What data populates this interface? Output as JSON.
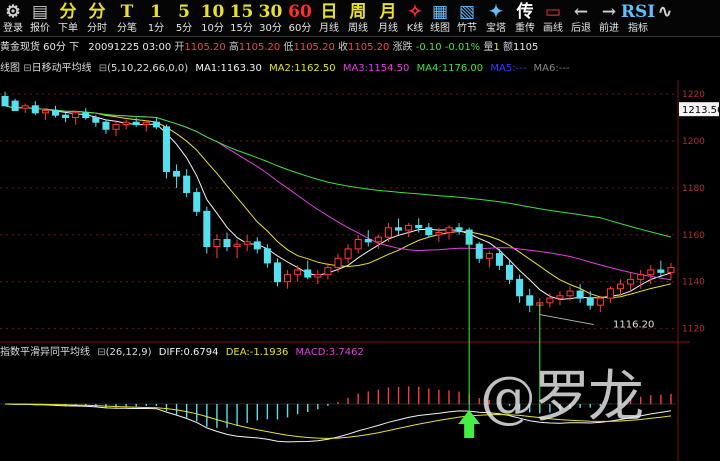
{
  "toolbar": [
    {
      "glyph": "⚙",
      "label": "登录",
      "color": "#d0d0d0",
      "w": 26
    },
    {
      "glyph": "▤",
      "label": "报价",
      "color": "#d0d0d0",
      "w": 28
    },
    {
      "glyph": "分",
      "label": "下单",
      "color": "#e8e030",
      "w": 28
    },
    {
      "glyph": "分",
      "label": "分时",
      "color": "#e8e030",
      "w": 30
    },
    {
      "glyph": "T",
      "label": "分笔",
      "color": "#e8e030",
      "w": 30
    },
    {
      "glyph": "1",
      "label": "1分",
      "color": "#e8e030",
      "w": 28
    },
    {
      "glyph": "5",
      "label": "5分",
      "color": "#e8e030",
      "w": 28
    },
    {
      "glyph": "10",
      "label": "10分",
      "color": "#e8e030",
      "w": 29
    },
    {
      "glyph": "15",
      "label": "15分",
      "color": "#e8e030",
      "w": 29
    },
    {
      "glyph": "30",
      "label": "30分",
      "color": "#e8e030",
      "w": 29
    },
    {
      "glyph": "60",
      "label": "60分",
      "color": "#ff3030",
      "w": 30
    },
    {
      "glyph": "日",
      "label": "月线",
      "color": "#e8e030",
      "w": 28
    },
    {
      "glyph": "周",
      "label": "周线",
      "color": "#e8e030",
      "w": 30
    },
    {
      "glyph": "月",
      "label": "月线",
      "color": "#e8e030",
      "w": 30
    },
    {
      "glyph": "✧",
      "label": "K线",
      "color": "#ff3030",
      "w": 24
    },
    {
      "glyph": "▦",
      "label": "线图",
      "color": "#60c0ff",
      "w": 26
    },
    {
      "glyph": "▧",
      "label": "竹节",
      "color": "#60c0ff",
      "w": 28
    },
    {
      "glyph": "✦",
      "label": "宝塔",
      "color": "#60c0ff",
      "w": 30
    },
    {
      "glyph": "传",
      "label": "重传",
      "color": "#ffffff",
      "w": 28
    },
    {
      "glyph": "▭",
      "label": "画线",
      "color": "#ff3030",
      "w": 28
    },
    {
      "glyph": "←",
      "label": "后退",
      "color": "#d0d0d0",
      "w": 28
    },
    {
      "glyph": "→",
      "label": "前进",
      "color": "#d0d0d0",
      "w": 28
    },
    {
      "glyph": "RSI",
      "label": "指标",
      "color": "#60c0ff",
      "w": 30
    },
    {
      "glyph": "∿",
      "label": "",
      "color": "#d0d0d0",
      "w": 24
    }
  ],
  "quote": {
    "name": "黄金现货 60分 下",
    "date": "20091225 03:00",
    "open_label": "开",
    "open": "1105.20",
    "high_label": "高",
    "high": "1105.20",
    "low_label": "低",
    "low": "1105.20",
    "close_label": "收",
    "close": "1105.20",
    "change_label": "涨跌",
    "change": "-0.10",
    "pct": "-0.01%",
    "volume_label": "量",
    "volume": "1",
    "hold_label": "额",
    "hold": "1105"
  },
  "ma_bar": {
    "title": "线图",
    "indicator": "日移动平均线",
    "params": "(5,10,22,66,0,0)",
    "ma1": "MA1:1163.30",
    "ma2": "MA2:1162.50",
    "ma3": "MA3:1154.50",
    "ma4": "MA4:1176.00",
    "ma5": "MA5:---",
    "ma6": "MA6:---"
  },
  "macd_bar": {
    "title": "指数平滑异同平均线",
    "params": "(26,12,9)",
    "diff": "DIFF:0.6794",
    "dea": "DEA:-1.1936",
    "macd": "MACD:3.7462"
  },
  "axis_labels": [
    "1220",
    "1200",
    "1180",
    "1160",
    "1140",
    "1120"
  ],
  "current_price_tag": "1213.56",
  "low_marker": "1116.20",
  "watermark": "@罗龙",
  "colors": {
    "up": "#ff3a3a",
    "down": "#54e0ee",
    "ma1": "#f4f4f4",
    "ma2": "#e8e030",
    "ma3": "#e040e0",
    "ma4": "#40e040",
    "signal_arrow": "#44ee44",
    "grid": "#7a1515"
  },
  "chart_data": {
    "type": "candlestick",
    "price_range": [
      1116,
      1226
    ],
    "price_labels": [
      1220,
      1200,
      1180,
      1160,
      1140,
      1120
    ],
    "candles": [
      [
        1219,
        1221,
        1217,
        1215
      ],
      [
        1217,
        1218,
        1214,
        1213
      ],
      [
        1214,
        1216,
        1212,
        1215
      ],
      [
        1215,
        1217,
        1211,
        1212
      ],
      [
        1212,
        1214,
        1209,
        1213
      ],
      [
        1213,
        1215,
        1210,
        1211
      ],
      [
        1211,
        1212,
        1208,
        1210
      ],
      [
        1210,
        1213,
        1207,
        1212
      ],
      [
        1212,
        1214,
        1209,
        1210
      ],
      [
        1210,
        1211,
        1206,
        1208
      ],
      [
        1208,
        1209,
        1203,
        1205
      ],
      [
        1205,
        1208,
        1202,
        1207
      ],
      [
        1207,
        1209,
        1205,
        1208
      ],
      [
        1208,
        1210,
        1206,
        1207
      ],
      [
        1207,
        1209,
        1204,
        1208
      ],
      [
        1208,
        1210,
        1205,
        1206
      ],
      [
        1206,
        1207,
        1184,
        1187
      ],
      [
        1187,
        1190,
        1180,
        1185
      ],
      [
        1185,
        1188,
        1176,
        1178
      ],
      [
        1178,
        1180,
        1168,
        1170
      ],
      [
        1170,
        1172,
        1152,
        1155
      ],
      [
        1155,
        1160,
        1150,
        1158
      ],
      [
        1158,
        1161,
        1153,
        1155
      ],
      [
        1155,
        1158,
        1150,
        1156
      ],
      [
        1156,
        1160,
        1153,
        1157
      ],
      [
        1157,
        1159,
        1152,
        1154
      ],
      [
        1154,
        1156,
        1146,
        1148
      ],
      [
        1148,
        1150,
        1138,
        1140
      ],
      [
        1140,
        1145,
        1137,
        1143
      ],
      [
        1143,
        1147,
        1140,
        1145
      ],
      [
        1145,
        1149,
        1141,
        1142
      ],
      [
        1142,
        1145,
        1139,
        1143
      ],
      [
        1143,
        1148,
        1141,
        1146
      ],
      [
        1146,
        1152,
        1144,
        1150
      ],
      [
        1150,
        1156,
        1148,
        1154
      ],
      [
        1154,
        1160,
        1152,
        1158
      ],
      [
        1158,
        1162,
        1155,
        1157
      ],
      [
        1157,
        1160,
        1154,
        1159
      ],
      [
        1159,
        1165,
        1157,
        1163
      ],
      [
        1163,
        1167,
        1160,
        1162
      ],
      [
        1162,
        1165,
        1159,
        1164
      ],
      [
        1164,
        1167,
        1161,
        1163
      ],
      [
        1163,
        1165,
        1159,
        1160
      ],
      [
        1160,
        1163,
        1157,
        1161
      ],
      [
        1161,
        1164,
        1158,
        1163
      ],
      [
        1163,
        1165,
        1160,
        1162
      ],
      [
        1162,
        1163,
        1154,
        1156
      ],
      [
        1156,
        1157,
        1148,
        1150
      ],
      [
        1150,
        1153,
        1146,
        1152
      ],
      [
        1152,
        1154,
        1145,
        1147
      ],
      [
        1147,
        1149,
        1139,
        1141
      ],
      [
        1141,
        1143,
        1131,
        1134
      ],
      [
        1134,
        1137,
        1127,
        1130
      ],
      [
        1130,
        1133,
        1126,
        1131
      ],
      [
        1131,
        1135,
        1129,
        1133
      ],
      [
        1133,
        1136,
        1130,
        1134
      ],
      [
        1134,
        1138,
        1132,
        1136
      ],
      [
        1136,
        1139,
        1131,
        1133
      ],
      [
        1133,
        1136,
        1128,
        1130
      ],
      [
        1130,
        1134,
        1127,
        1133
      ],
      [
        1133,
        1138,
        1131,
        1137
      ],
      [
        1137,
        1141,
        1134,
        1139
      ],
      [
        1139,
        1144,
        1136,
        1141
      ],
      [
        1141,
        1145,
        1137,
        1143
      ],
      [
        1143,
        1147,
        1139,
        1145
      ],
      [
        1145,
        1149,
        1142,
        1144
      ],
      [
        1144,
        1148,
        1141,
        1146
      ]
    ]
  }
}
